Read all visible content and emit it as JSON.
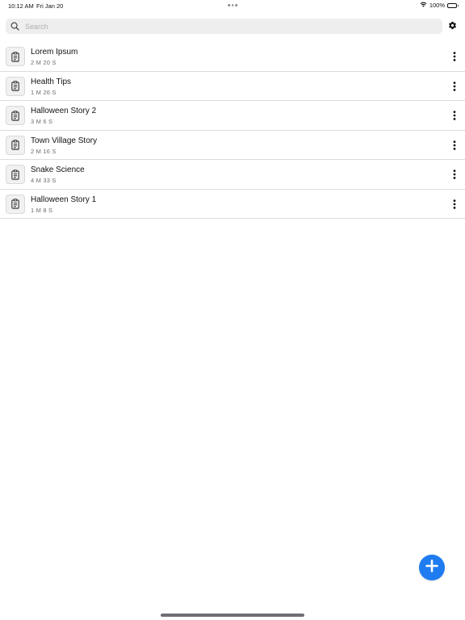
{
  "status_bar": {
    "time": "10:12 AM",
    "date": "Fri Jan 20",
    "battery": "100%"
  },
  "search": {
    "placeholder": "Search",
    "value": ""
  },
  "icons": {
    "search": "search-icon",
    "settings": "gear-icon",
    "item": "clipboard-icon",
    "more": "more-vertical-icon",
    "add": "plus-icon",
    "wifi": "wifi-icon",
    "battery": "battery-icon"
  },
  "colors": {
    "accent": "#1e7cf0"
  },
  "list": {
    "items": [
      {
        "title": "Lorem Ipsum",
        "duration": "2 M 20 S"
      },
      {
        "title": "Health Tips",
        "duration": "1 M 26 S"
      },
      {
        "title": "Halloween Story 2",
        "duration": "3 M 6 S"
      },
      {
        "title": "Town Village Story",
        "duration": "2 M 16 S"
      },
      {
        "title": "Snake Science",
        "duration": "4 M 33 S"
      },
      {
        "title": "Halloween Story 1",
        "duration": "1 M 8 S"
      }
    ]
  }
}
